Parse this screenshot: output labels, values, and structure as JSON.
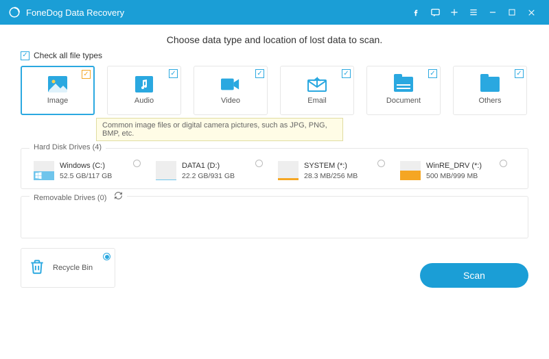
{
  "titlebar": {
    "title": "FoneDog Data Recovery"
  },
  "heading": "Choose data type and location of lost data to scan.",
  "checkall_label": "Check all file types",
  "types": {
    "image": "Image",
    "audio": "Audio",
    "video": "Video",
    "email": "Email",
    "document": "Document",
    "others": "Others"
  },
  "tooltip": "Common image files or digital camera pictures, such as JPG, PNG, BMP, etc.",
  "hdd": {
    "legend": "Hard Disk Drives (4)",
    "items": [
      {
        "name": "Windows (C:)",
        "size": "52.5 GB/117 GB",
        "color": "#6fc5ec",
        "fill": 45
      },
      {
        "name": "DATA1 (D:)",
        "size": "22.2 GB/931 GB",
        "color": "#6fc5ec",
        "fill": 4
      },
      {
        "name": "SYSTEM (*:)",
        "size": "28.3 MB/256 MB",
        "color": "#f5a623",
        "fill": 12
      },
      {
        "name": "WinRE_DRV (*:)",
        "size": "500 MB/999 MB",
        "color": "#f5a623",
        "fill": 50
      }
    ]
  },
  "removable": {
    "legend": "Removable Drives (0)"
  },
  "recycle_label": "Recycle Bin",
  "scan_label": "Scan"
}
